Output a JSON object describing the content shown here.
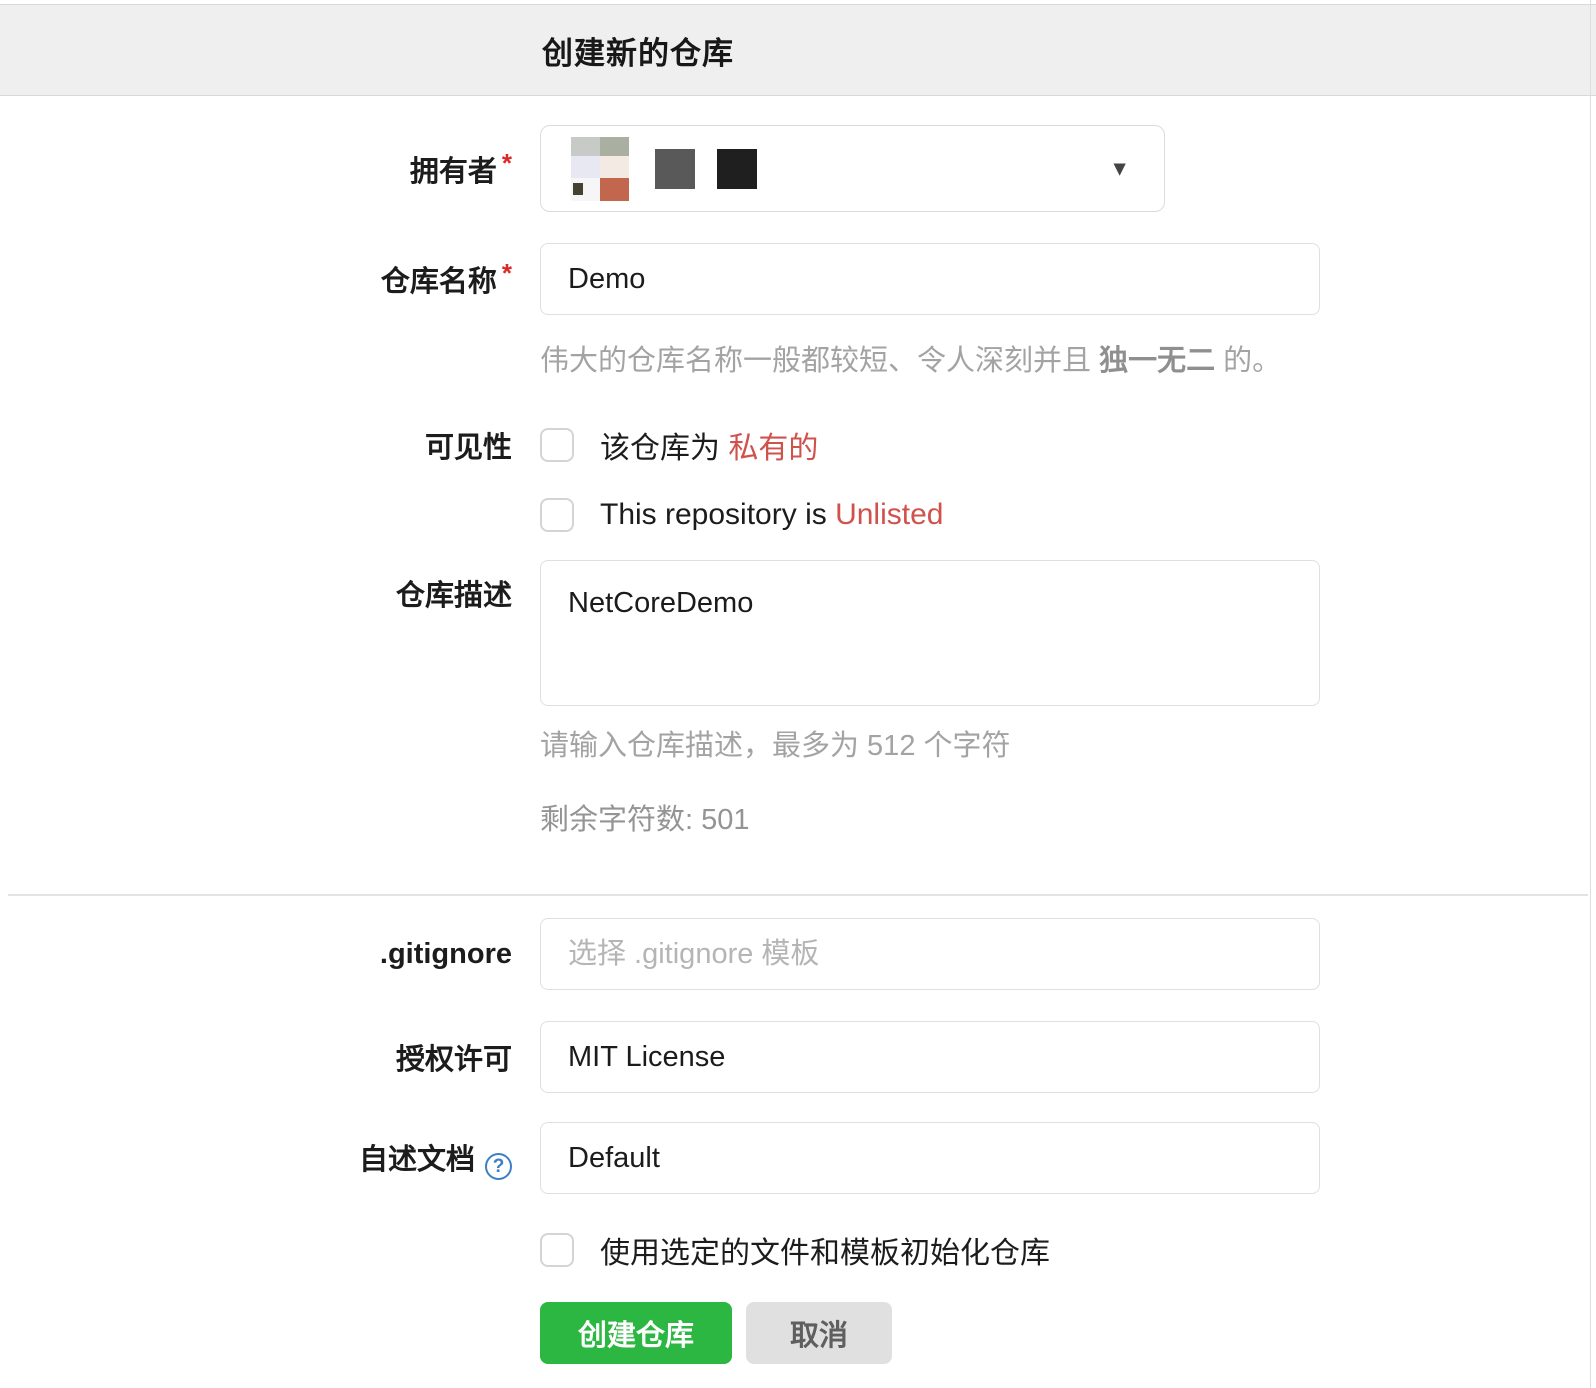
{
  "header": {
    "title": "创建新的仓库"
  },
  "colors": {
    "accent_green": "#2cb642",
    "danger_red": "#d0524d",
    "link_blue": "#3b7fc4",
    "header_bg": "#efefef"
  },
  "owner": {
    "label": "拥有者",
    "required_mark": "*",
    "caret_icon": "▼",
    "avatar_palette": [
      "#c7cbc7",
      "#a9b0a2",
      "#e8e8f3",
      "#f3eae3",
      "#f6f6f6",
      "#c2664e"
    ],
    "redacted_blocks": [
      "#595959",
      "#1f1f1f"
    ]
  },
  "repo_name": {
    "label": "仓库名称",
    "required_mark": "*",
    "value": "Demo",
    "help_prefix": "伟大的仓库名称一般都较短、令人深刻并且 ",
    "help_bold": "独一无二",
    "help_suffix": " 的。"
  },
  "visibility": {
    "label": "可见性",
    "private_prefix": "该仓库为 ",
    "private_highlight": "私有的",
    "unlisted_prefix": "This repository is ",
    "unlisted_highlight": "Unlisted"
  },
  "description": {
    "label": "仓库描述",
    "value": "NetCoreDemo",
    "help": "请输入仓库描述，最多为 512 个字符",
    "remaining": "剩余字符数: 501"
  },
  "gitignore": {
    "label": ".gitignore",
    "placeholder": "选择 .gitignore 模板"
  },
  "license": {
    "label": "授权许可",
    "value": "MIT License"
  },
  "readme": {
    "label": "自述文档",
    "help_icon": "?",
    "value": "Default"
  },
  "init": {
    "label": "使用选定的文件和模板初始化仓库"
  },
  "actions": {
    "create": "创建仓库",
    "cancel": "取消"
  }
}
